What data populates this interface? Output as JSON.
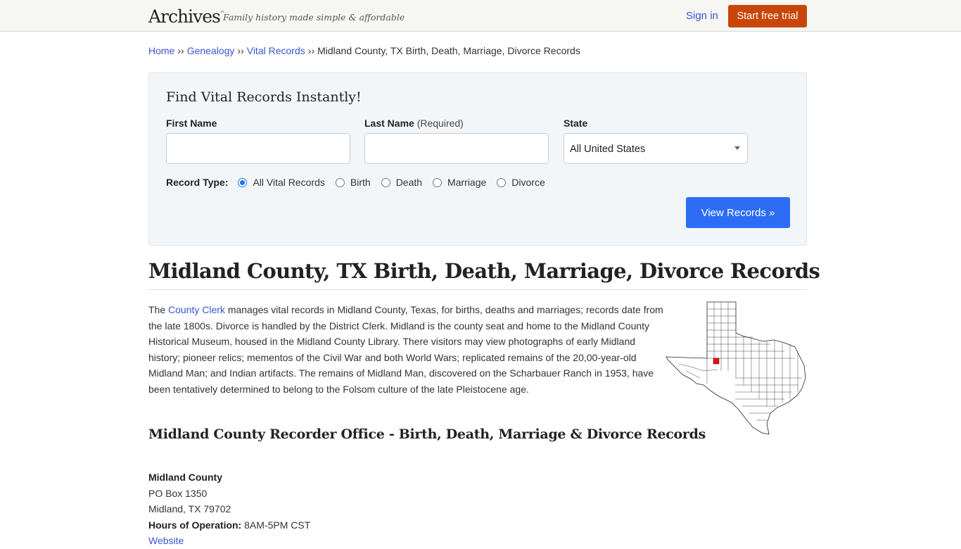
{
  "header": {
    "logo": "Archives",
    "logo_mark": "™",
    "tagline": "Family history made simple & affordable",
    "sign_in": "Sign in",
    "start_trial": "Start free trial"
  },
  "breadcrumb": {
    "items": [
      "Home",
      "Genealogy",
      "Vital Records"
    ],
    "separator": "››",
    "current": "Midland County, TX Birth, Death, Marriage, Divorce Records"
  },
  "search": {
    "title": "Find Vital Records Instantly!",
    "first_name_label": "First Name",
    "first_name_value": "",
    "last_name_label": "Last Name",
    "last_name_note": "(Required)",
    "last_name_value": "",
    "state_label": "State",
    "state_value": "All United States",
    "record_type_label": "Record Type:",
    "record_types": [
      {
        "label": "All Vital Records",
        "checked": true
      },
      {
        "label": "Birth",
        "checked": false
      },
      {
        "label": "Death",
        "checked": false
      },
      {
        "label": "Marriage",
        "checked": false
      },
      {
        "label": "Divorce",
        "checked": false
      }
    ],
    "submit": "View Records »"
  },
  "main": {
    "title": "Midland County, TX Birth, Death, Marriage, Divorce Records",
    "intro_prefix": "The ",
    "intro_link": "County Clerk",
    "intro_rest": " manages vital records in Midland County, Texas, for births, deaths and marriages; records date from the late 1800s. Divorce is handled by the District Clerk. Midland is the county seat and home to the Midland County Historical Museum, housed in the Midland County Library. There visitors may view photographs of early Midland history; pioneer relics; mementos of the Civil War and both World Wars; replicated remains of the 20,00-year-old Midland Man; and Indian artifacts. The remains of Midland Man, discovered on the Scharbauer Ranch in 1953, have been tentatively determined to belong to the Folsom culture of the late Pleistocene age.",
    "map": {
      "state": "Texas",
      "highlight": "Midland County",
      "highlight_color": "#ff0000"
    },
    "subheading": "Midland County Recorder Office - Birth, Death, Marriage & Divorce Records",
    "office": {
      "name": "Midland County",
      "address1": "PO Box 1350",
      "address2": "Midland, TX 79702",
      "hours_label": "Hours of Operation:",
      "hours": "8AM-5PM CST",
      "website": "Website"
    }
  },
  "colors": {
    "link": "#3a55d4",
    "trial_button": "#c9460b",
    "view_button": "#2d6df6"
  }
}
